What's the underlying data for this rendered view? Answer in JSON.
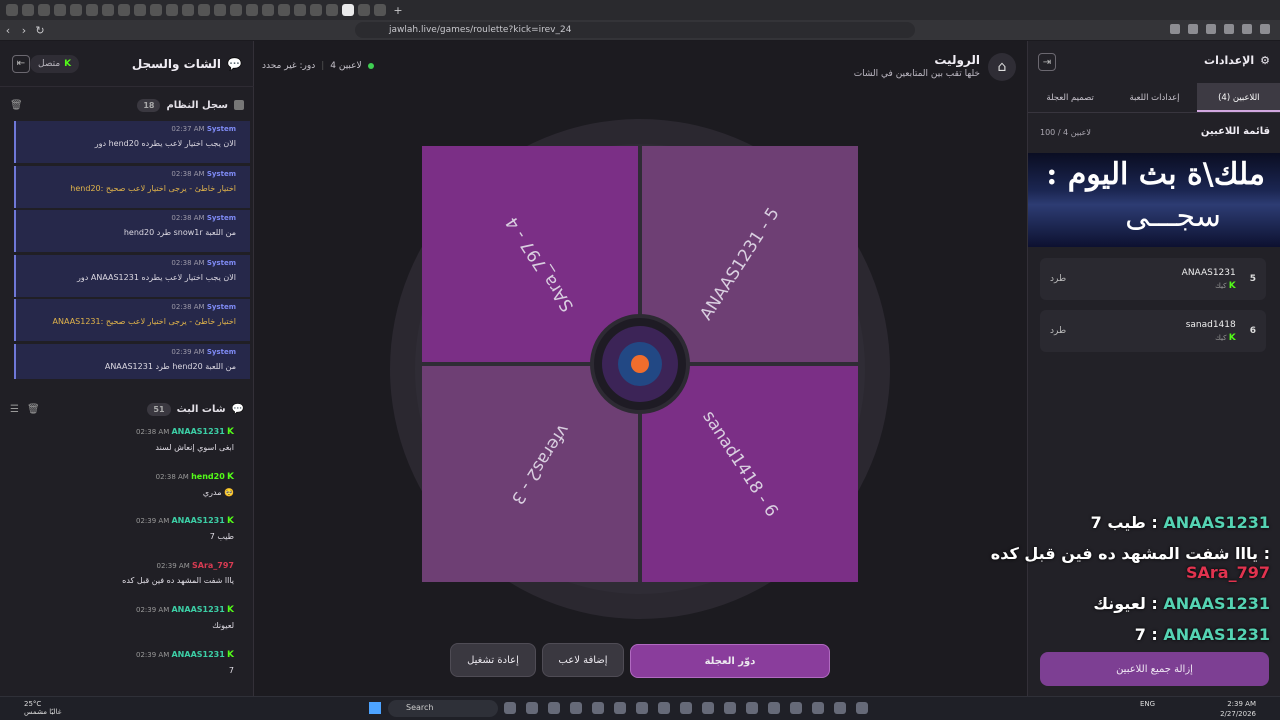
{
  "browser": {
    "url": "jawlah.live/games/roulette?kick=irev_24"
  },
  "chat_panel": {
    "title": "الشات والسجل",
    "status": "متصل",
    "syslog": {
      "title": "سجل النظام",
      "count": "18",
      "messages": [
        {
          "time": "02:37 AM",
          "user": "System",
          "text": "دور hend20 الان يجب اختيار لاعب يطرده",
          "warn": false
        },
        {
          "time": "02:38 AM",
          "user": "System",
          "text": "hend20: اختيار خاطئ - يرجى اختيار لاعب صحيح",
          "warn": true
        },
        {
          "time": "02:38 AM",
          "user": "System",
          "text": "hend20 طرد snow1r من اللعبة",
          "warn": false
        },
        {
          "time": "02:38 AM",
          "user": "System",
          "text": "دور ANAAS1231 الان يجب اختيار لاعب يطرده",
          "warn": false
        },
        {
          "time": "02:38 AM",
          "user": "System",
          "text": "ANAAS1231: اختيار خاطئ - يرجى اختيار لاعب صحيح",
          "warn": true
        },
        {
          "time": "02:39 AM",
          "user": "System",
          "text": "ANAAS1231 طرد hend20 من اللعبة",
          "warn": false
        }
      ]
    },
    "stream_chat": {
      "title": "شات البث",
      "count": "51",
      "messages": [
        {
          "time": "02:38 AM",
          "user": "ANAAS1231",
          "color": "#3ccfa6",
          "text": "ابغى اسوي إنعاش لسند"
        },
        {
          "time": "02:38 AM",
          "user": "hend20",
          "color": "#53fc18",
          "text": "مدري 🥺"
        },
        {
          "time": "02:39 AM",
          "user": "ANAAS1231",
          "color": "#3ccfa6",
          "text": "طيب 7"
        },
        {
          "time": "02:39 AM",
          "user": "SAra_797",
          "color": "#d83b52",
          "text": "يااا شفت المشهد ده فين قبل كده"
        },
        {
          "time": "02:39 AM",
          "user": "ANAAS1231",
          "color": "#3ccfa6",
          "text": "لعيونك"
        },
        {
          "time": "02:39 AM",
          "user": "ANAAS1231",
          "color": "#3ccfa6",
          "text": "7"
        }
      ]
    }
  },
  "main": {
    "title": "الروليت",
    "subtitle": "خلها تقب بين المتابعين في الشات",
    "players_count": "4 لاعبين",
    "turn": "دور: غير محدد",
    "wheel": {
      "segments": [
        {
          "label": "ANAAS1231 - 5",
          "color": "#6e3f74"
        },
        {
          "label": "sanad1418 - 6",
          "color": "#7b2f86"
        },
        {
          "label": "vferas2 - 3",
          "color": "#6e3f74"
        },
        {
          "label": "SAra_797 - 4",
          "color": "#7b2f86"
        }
      ]
    },
    "buttons": {
      "spin": "دوّر العجلة",
      "add": "إضافة لاعب",
      "reset": "إعادة تشغيل"
    }
  },
  "settings": {
    "title": "الإعدادات",
    "tabs": [
      "اللاعبين (4)",
      "إعدادات اللعبة",
      "تصميم العجلة"
    ],
    "active_tab": 0,
    "players_title": "قائمة اللاعبين",
    "players_count": "100 / 4 لاعبين",
    "banner_line1": ": ملك\\ة بث اليوم",
    "banner_line2": "سجـــى",
    "players": [
      {
        "num": "5",
        "name": "ANAAS1231",
        "platform": "كيك",
        "kick_label": "طرد"
      },
      {
        "num": "6",
        "name": "sanad1418",
        "platform": "كيك",
        "kick_label": "طرد"
      }
    ],
    "remove_all": "إزالة جميع اللاعبين"
  },
  "overlay_chat": [
    {
      "user": "ANAAS1231",
      "text": "طيب 7",
      "red": false
    },
    {
      "user": "SAra_797",
      "text": "يااا شفت المشهد ده فين قبل كده",
      "red": true
    },
    {
      "user": "ANAAS1231",
      "text": "لعيونك",
      "red": false
    },
    {
      "user": "ANAAS1231",
      "text": "7",
      "red": false
    }
  ],
  "taskbar": {
    "weather_temp": "25°C",
    "weather_desc": "غالبًا مشمس",
    "search": "Search",
    "lang": "ENG",
    "time": "2:39 AM",
    "date": "2/27/2026"
  }
}
